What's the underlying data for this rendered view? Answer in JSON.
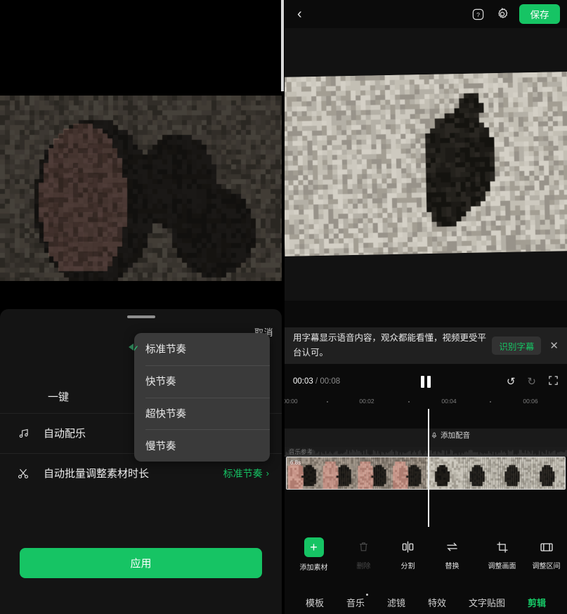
{
  "left": {
    "sheet": {
      "cancel_label": "取消",
      "onekey_label": "一键",
      "rows": [
        {
          "icon": "music-note-icon",
          "label": "自动配乐",
          "value": ""
        },
        {
          "icon": "scissors-icon",
          "label": "自动批量调整素材时长",
          "value": "标准节奏",
          "chevron": "›"
        }
      ],
      "apply_label": "应用"
    },
    "dropdown": {
      "check_glyph": "✓",
      "items": [
        {
          "label": "标准节奏",
          "selected": true
        },
        {
          "label": "快节奏",
          "selected": false
        },
        {
          "label": "超快节奏",
          "selected": false
        },
        {
          "label": "慢节奏",
          "selected": false
        }
      ]
    }
  },
  "right": {
    "header": {
      "back_icon": "‹",
      "help_icon": "?",
      "settings_icon": "gear-icon",
      "save_label": "保存"
    },
    "subtitle_banner": {
      "text": "用字幕显示语音内容，观众都能看懂，视频更受平台认可。",
      "cta_label": "识别字幕",
      "close_glyph": "✕"
    },
    "player": {
      "current_time": "00:03",
      "separator": " / ",
      "total_time": "00:08",
      "undo_glyph": "↺",
      "redo_glyph": "↻",
      "fullscreen_icon": "fullscreen-icon"
    },
    "timeline": {
      "ticks": [
        "00:00",
        "00:02",
        "00:04",
        "00:06"
      ],
      "add_voice_label": "添加配音",
      "music_track_label": "音乐参考",
      "clip_badge": "6.8s"
    },
    "toolbar": [
      {
        "name": "add-material",
        "label": "添加素材",
        "icon": "plus-icon",
        "disabled": false
      },
      {
        "name": "delete",
        "label": "删除",
        "icon": "trash-icon",
        "disabled": true
      },
      {
        "name": "split",
        "label": "分割",
        "icon": "split-icon",
        "disabled": false
      },
      {
        "name": "replace",
        "label": "替换",
        "icon": "swap-icon",
        "disabled": false
      },
      {
        "name": "adjust-frame",
        "label": "调整画面",
        "icon": "crop-icon",
        "disabled": false
      },
      {
        "name": "adjust-range",
        "label": "调整区间",
        "icon": "film-icon",
        "disabled": false
      }
    ],
    "tabs": [
      {
        "label": "模板",
        "active": false,
        "dot": false
      },
      {
        "label": "音乐",
        "active": false,
        "dot": true
      },
      {
        "label": "滤镜",
        "active": false,
        "dot": false
      },
      {
        "label": "特效",
        "active": false,
        "dot": false
      },
      {
        "label": "文字贴图",
        "active": false,
        "dot": false
      },
      {
        "label": "剪辑",
        "active": true,
        "dot": false
      }
    ]
  },
  "colors": {
    "accent_green": "#16C464",
    "sheet_bg": "#141414",
    "dropdown_bg": "#3a3a3a"
  }
}
